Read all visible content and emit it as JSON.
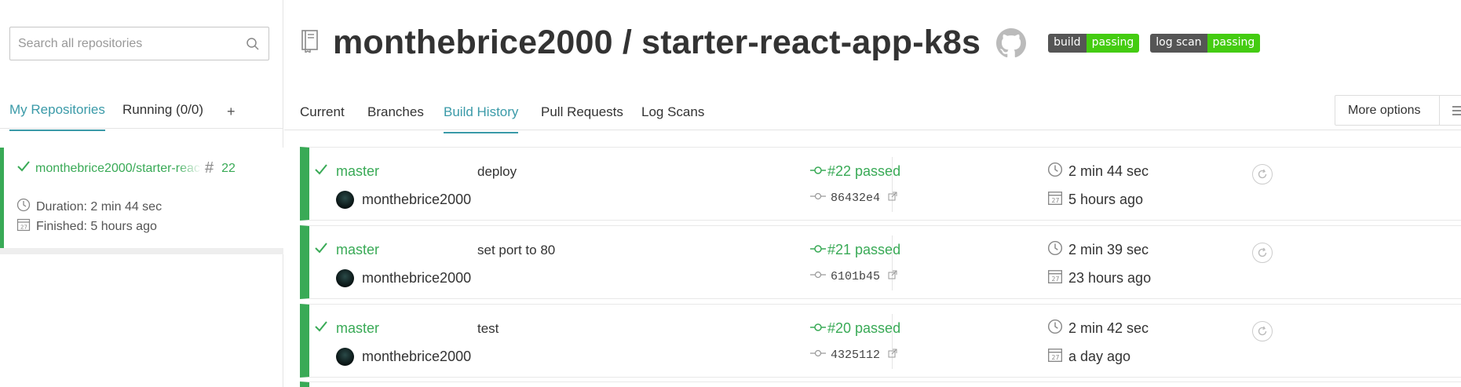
{
  "sidebar": {
    "search": {
      "placeholder": "Search all repositories"
    },
    "tabs": [
      {
        "label": "My Repositories",
        "active": true
      },
      {
        "label": "Running (0/0)",
        "active": false
      },
      {
        "label": "+",
        "active": false
      }
    ],
    "repo": {
      "name": "monthebrice2000/starter-react-app-k8s",
      "build_number": "22",
      "duration": "Duration: 2 min 44 sec",
      "finished": "Finished: 5 hours ago",
      "status_color": "#39aa56"
    }
  },
  "header": {
    "owner": "monthebrice2000",
    "separator": "/",
    "repo": "starter-react-app-k8s",
    "title": "monthebrice2000 / starter-react-app-k8s",
    "badges": [
      {
        "label": "build",
        "value": "passing",
        "color": "#44cc11"
      },
      {
        "label": "log scan",
        "value": "passing",
        "color": "#44cc11"
      }
    ]
  },
  "nav": {
    "tabs": [
      {
        "label": "Current",
        "active": false
      },
      {
        "label": "Branches",
        "active": false
      },
      {
        "label": "Build History",
        "active": true
      },
      {
        "label": "Pull Requests",
        "active": false
      },
      {
        "label": "Log Scans",
        "active": false
      }
    ],
    "more_options": "More options"
  },
  "builds": [
    {
      "branch": "master",
      "author": "monthebrice2000",
      "message": "deploy",
      "status": "#22 passed",
      "commit": "86432e4",
      "duration": "2 min 44 sec",
      "finished": "5 hours ago"
    },
    {
      "branch": "master",
      "author": "monthebrice2000",
      "message": "set port to 80",
      "status": "#21 passed",
      "commit": "6101b45",
      "duration": "2 min 39 sec",
      "finished": "23 hours ago"
    },
    {
      "branch": "master",
      "author": "monthebrice2000",
      "message": "test",
      "status": "#20 passed",
      "commit": "4325112",
      "duration": "2 min 42 sec",
      "finished": "a day ago"
    }
  ],
  "colors": {
    "accent": "#3a9aa8",
    "passed": "#39aa56",
    "badge_green": "#44cc11",
    "badge_gray": "#555555"
  },
  "icons": [
    "search-icon",
    "check-icon",
    "hash-icon",
    "clock-icon",
    "calendar-icon",
    "repo-book-icon",
    "github-icon",
    "commit-icon",
    "external-link-icon",
    "restart-icon",
    "hamburger-icon"
  ]
}
